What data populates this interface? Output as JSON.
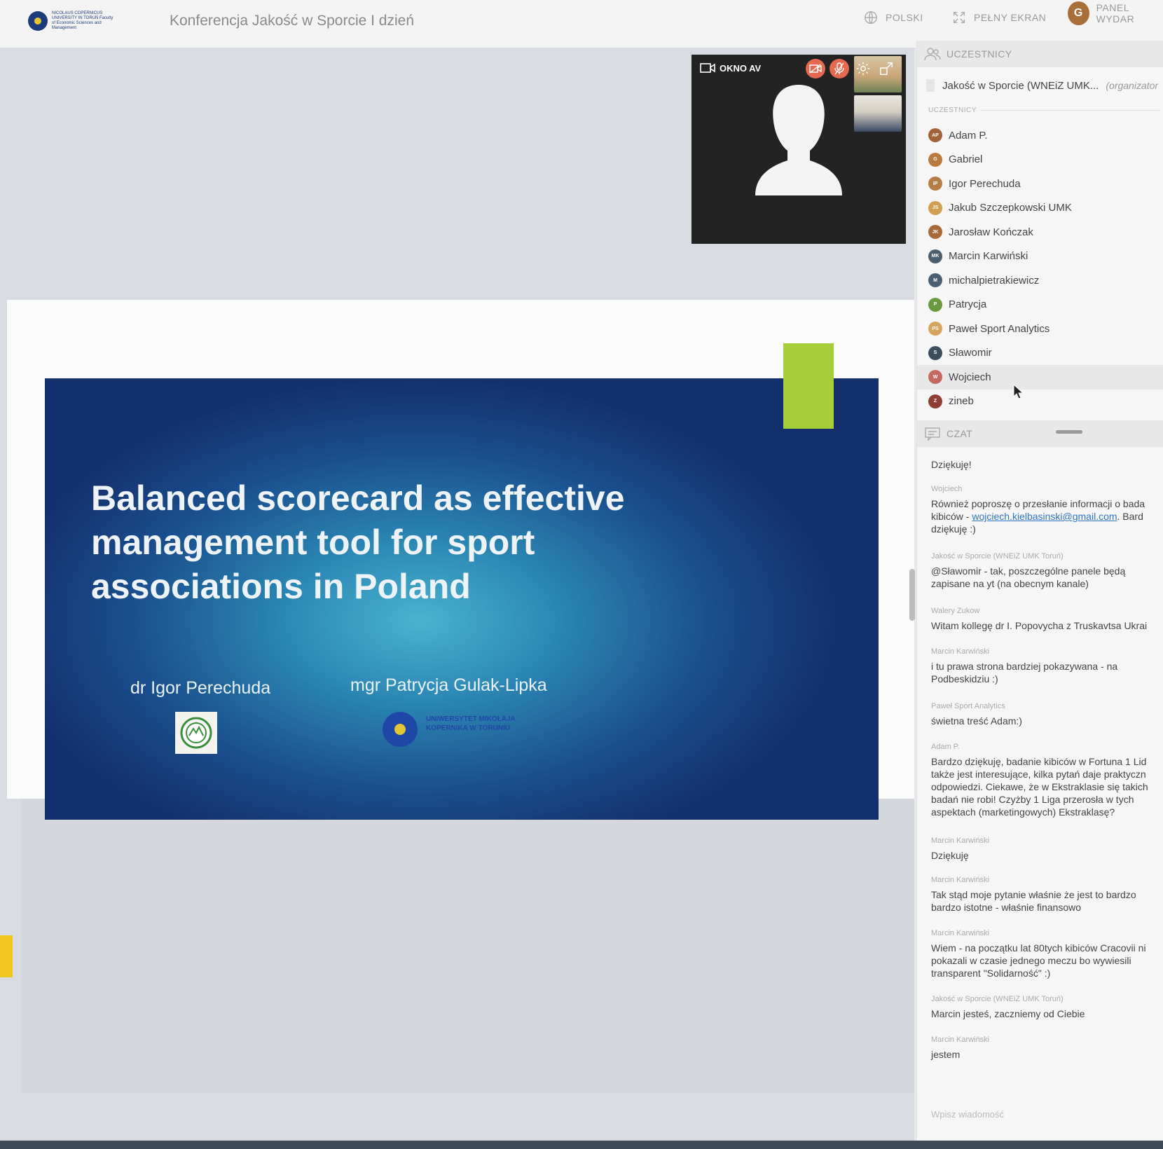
{
  "header": {
    "logo_text": "NICOLAUS COPERNICUS UNIVERSITY IN TORUŃ Faculty of Economic Sciences and Management",
    "conference_title": "Konferencja Jakość w Sporcie I dzień",
    "language_label": "POLSKI",
    "fullscreen_label": "PEŁNY EKRAN",
    "user_initial": "G",
    "panel_label": "PANEL WYDAR"
  },
  "slide": {
    "title": "Balanced scorecard as effective management tool for sport associations in Poland",
    "author_1": "dr Igor Perechuda",
    "author_2": "mgr Patrycja Gulak-Lipka",
    "university_text": "UNIWERSYTET MIKOŁAJA KOPERNIKA W TORUNIU"
  },
  "av_window": {
    "label": "OKNO AV"
  },
  "participants": {
    "header": "UCZESTNICY",
    "host_name": "Jakość w Sporcie (WNEiZ UMK...",
    "host_role": "(organizator",
    "section_label": "UCZESTNICY",
    "items": [
      {
        "initials": "AP",
        "name": "Adam P.",
        "color": "#a3633a"
      },
      {
        "initials": "G",
        "name": "Gabriel",
        "color": "#b87a3e"
      },
      {
        "initials": "IP",
        "name": "Igor Perechuda",
        "color": "#b57d45"
      },
      {
        "initials": "JS",
        "name": "Jakub Szczepkowski UMK",
        "color": "#d0a050"
      },
      {
        "initials": "JK",
        "name": "Jarosław Kończak",
        "color": "#a86a38"
      },
      {
        "initials": "MK",
        "name": "Marcin Karwiński",
        "color": "#4b5e6e"
      },
      {
        "initials": "M",
        "name": "michalpietrakiewicz",
        "color": "#4a5f74"
      },
      {
        "initials": "P",
        "name": "Patrycja",
        "color": "#6a9a3f"
      },
      {
        "initials": "PS",
        "name": "Paweł Sport Analytics",
        "color": "#d6a45c"
      },
      {
        "initials": "S",
        "name": "Sławomir",
        "color": "#3c4d5e"
      },
      {
        "initials": "W",
        "name": "Wojciech",
        "color": "#c46860"
      },
      {
        "initials": "Z",
        "name": "zineb",
        "color": "#8e3e33"
      }
    ]
  },
  "chat": {
    "header": "CZAT",
    "input_placeholder": "Wpisz wiadomość",
    "messages": [
      {
        "author": "",
        "text": "Dziękuję!"
      },
      {
        "author": "Wojciech",
        "text_before": "Również poproszę o przesłanie informacji o bada kibiców - ",
        "link": "wojciech.kielbasinski@gmail.com",
        "text_after": ". Bard dziękuję :)"
      },
      {
        "author": "Jakość w Sporcie (WNEiZ UMK Toruń)",
        "text": "@Sławomir - tak, poszczególne panele będą zapisane na yt (na obecnym kanale)"
      },
      {
        "author": "Walery Zukow",
        "text": "Witam kollegę dr I. Popovycha z Truskavtsa Ukrai"
      },
      {
        "author": "Marcin Karwiński",
        "text": "i tu prawa strona bardziej pokazywana - na Podbeskidziu :)"
      },
      {
        "author": "Paweł Sport Analytics",
        "text": "świetna treść Adam:)"
      },
      {
        "author": "Adam P.",
        "text": "Bardzo dziękuję, badanie kibiców w Fortuna 1 Lid także jest interesujące, kilka pytań daje praktyczn odpowiedzi. Ciekawe, że w Ekstraklasie się takich badań nie robi! Czyżby 1 Liga przerosła w tych aspektach (marketingowych) Ekstraklasę?"
      },
      {
        "author": "Marcin Karwiński",
        "text": "Dziękuję"
      },
      {
        "author": "Marcin Karwiński",
        "text": "Tak stąd moje pytanie właśnie że jest to bardzo bardzo istotne - właśnie finansowo"
      },
      {
        "author": "Marcin Karwiński",
        "text": "Wiem - na początku lat 80tych kibiców Cracovii ni pokazali w czasie jednego meczu bo wywiesili transparent \"Solidarność\" :)"
      },
      {
        "author": "Jakość w Sporcie (WNEiZ UMK Toruń)",
        "text": "Marcin jesteś, zaczniemy od Ciebie"
      },
      {
        "author": "Marcin Karwiński",
        "text": "jestem"
      }
    ]
  }
}
